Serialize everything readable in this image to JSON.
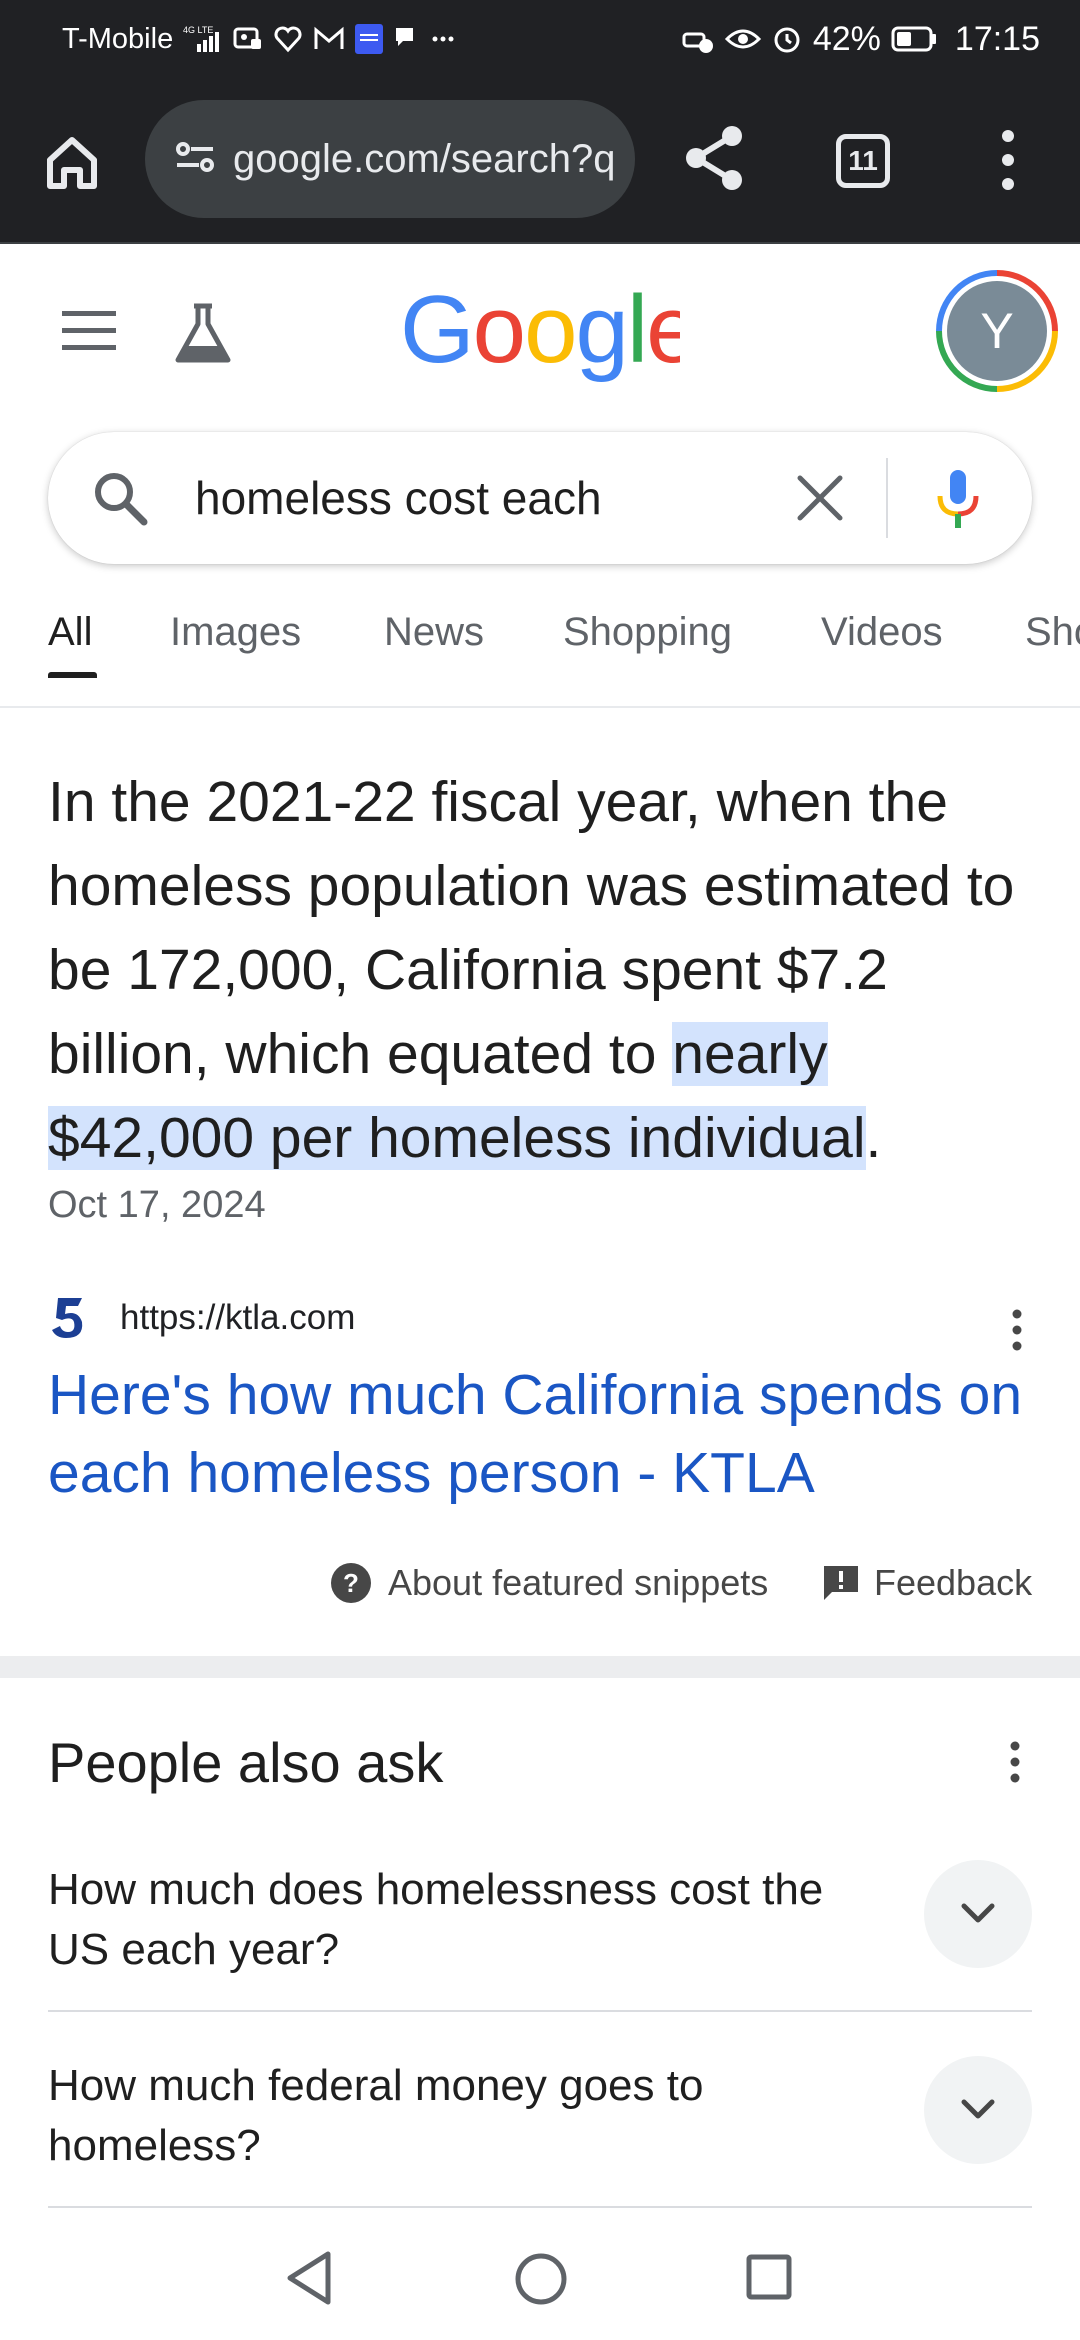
{
  "status_bar": {
    "carrier": "T-Mobile",
    "network": "4G LTE",
    "battery": "42%",
    "time": "17:15",
    "icons": [
      "signal-icon",
      "photo-icon",
      "heart-icon",
      "gmail-icon",
      "news-icon",
      "chat-icon",
      "more-dots-icon",
      "car-icon",
      "eye-icon",
      "alarm-icon",
      "battery-icon"
    ]
  },
  "browser": {
    "url": "google.com/search?q",
    "tab_count": "11",
    "icons": [
      "home-icon",
      "site-settings-icon",
      "share-icon",
      "tabs-icon",
      "overflow-menu-icon"
    ]
  },
  "google": {
    "logo": "Google",
    "avatar_letter": "Y",
    "colors": {
      "blue": "#4285f4",
      "red": "#ea4335",
      "yellow": "#fbbc05",
      "green": "#34a853",
      "avatar": "#7a8b97"
    }
  },
  "search": {
    "query": "homeless cost each"
  },
  "tabs": [
    "All",
    "Images",
    "News",
    "Shopping",
    "Videos",
    "Sho"
  ],
  "snippet": {
    "text_before": "In the 2021-22 fiscal year, when the homeless population was estimated to be 172,000, California spent $7.2 billion, which equated to ",
    "text_highlight": "nearly $42,000 per homeless individual",
    "text_after": ".",
    "date": "Oct 17, 2024",
    "source_url": "https://ktla.com",
    "result_title": "Here's how much California spends on each homeless person - KTLA",
    "about_label": "About featured snippets",
    "feedback_label": "Feedback"
  },
  "people_also_ask": {
    "title": "People also ask",
    "questions": [
      "How much does homelessness cost the US each year?",
      "How much federal money goes to homeless?"
    ]
  },
  "nav": {
    "icons": [
      "back-icon",
      "home-circle-icon",
      "recents-icon"
    ]
  }
}
